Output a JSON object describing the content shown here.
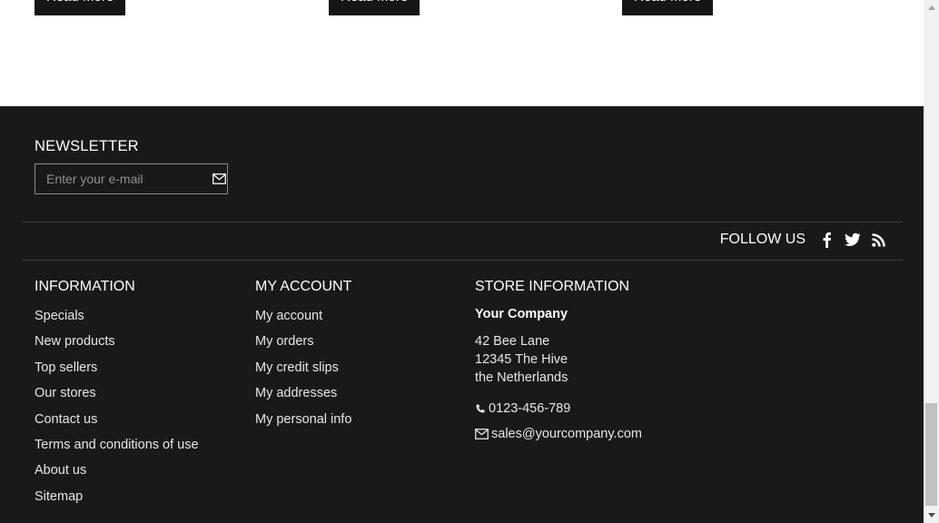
{
  "top": {
    "read_more_buttons": [
      "Read More",
      "Read More",
      "Read More"
    ]
  },
  "newsletter": {
    "title": "NEWSLETTER",
    "input_placeholder": "Enter your e-mail",
    "submit_icon": "envelope-icon"
  },
  "follow": {
    "label": "FOLLOW US",
    "icons": [
      "facebook-icon",
      "twitter-icon",
      "rss-icon"
    ]
  },
  "information": {
    "title": "INFORMATION",
    "links": [
      "Specials",
      "New products",
      "Top sellers",
      "Our stores",
      "Contact us",
      "Terms and conditions of use",
      "About us",
      "Sitemap"
    ]
  },
  "my_account": {
    "title": "MY ACCOUNT",
    "links": [
      "My account",
      "My orders",
      "My credit slips",
      "My addresses",
      "My personal info"
    ]
  },
  "store": {
    "title": "STORE INFORMATION",
    "company": "Your Company",
    "address_line1": "42 Bee Lane",
    "address_line2": "12345 The Hive",
    "address_line3": "the Netherlands",
    "phone": "0123-456-789",
    "email": "sales@yourcompany.com",
    "phone_icon": "phone-icon",
    "email_icon": "envelope-icon"
  },
  "colors": {
    "footer_bg": "#1a1919",
    "button_bg": "#161616",
    "text": "#ffffff"
  }
}
